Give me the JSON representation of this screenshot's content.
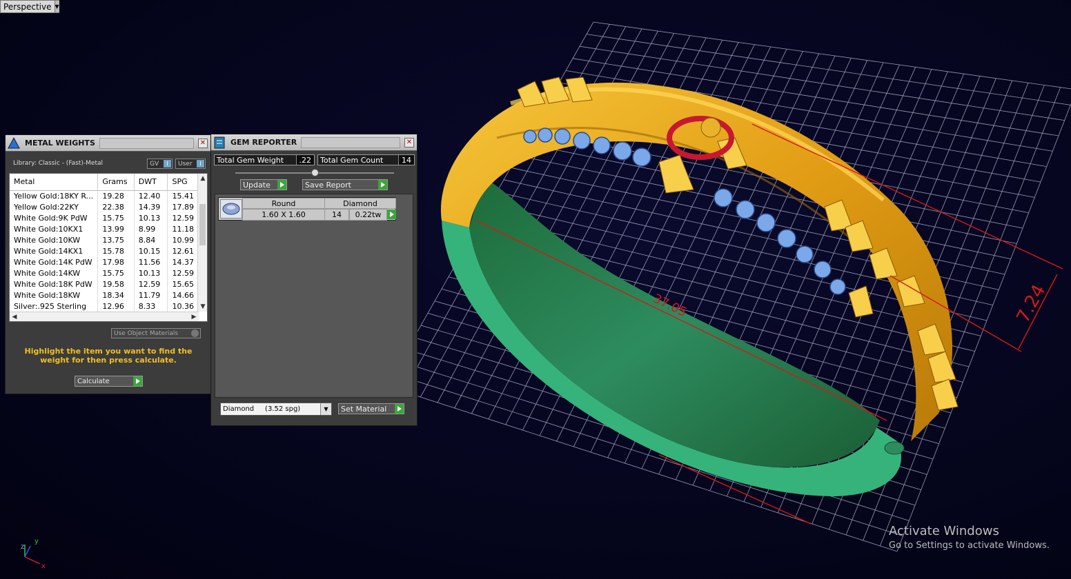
{
  "viewport": {
    "mode_label": "Perspective",
    "dimension_vertical": "7.24",
    "dimension_diagonal": "37.05",
    "axis_labels": [
      "z",
      "y",
      "x"
    ]
  },
  "metal_weights": {
    "title": "METAL WEIGHTS",
    "library": "Library: Classic - (Fast)-Metal",
    "toggle_gv": "GV",
    "toggle_user": "User",
    "columns": [
      "Metal",
      "Grams",
      "DWT",
      "SPG"
    ],
    "rows": [
      [
        "Yellow Gold:18KY R...",
        "19.28",
        "12.40",
        "15.41"
      ],
      [
        "Yellow Gold:22KY",
        "22.38",
        "14.39",
        "17.89"
      ],
      [
        "White Gold:9K PdW",
        "15.75",
        "10.13",
        "12.59"
      ],
      [
        "White Gold:10KX1",
        "13.99",
        "8.99",
        "11.18"
      ],
      [
        "White Gold:10KW",
        "13.75",
        "8.84",
        "10.99"
      ],
      [
        "White Gold:14KX1",
        "15.78",
        "10.15",
        "12.61"
      ],
      [
        "White Gold:14K PdW",
        "17.98",
        "11.56",
        "14.37"
      ],
      [
        "White Gold:14KW",
        "15.75",
        "10.13",
        "12.59"
      ],
      [
        "White Gold:18K PdW",
        "19.58",
        "12.59",
        "15.65"
      ],
      [
        "White Gold:18KW",
        "18.34",
        "11.79",
        "14.66"
      ],
      [
        "Silver:.925 Sterling",
        "12.96",
        "8.33",
        "10.36"
      ]
    ],
    "use_object_materials": "Use Object Materials",
    "hint": "Highlight the item you want to find the weight for then press calculate.",
    "calculate": "Calculate"
  },
  "gem_reporter": {
    "title": "GEM REPORTER",
    "total_weight_label": "Total Gem Weight",
    "total_weight_value": ".22",
    "total_count_label": "Total Gem Count",
    "total_count_value": "14",
    "update": "Update",
    "save_report": "Save Report",
    "gem": {
      "shape": "Round",
      "type": "Diamond",
      "size": "1.60 X 1.60",
      "count": "14",
      "weight": "0.22tw"
    },
    "material_select": "Diamond     (3.52 spg)",
    "set_material": "Set Material"
  },
  "watermark": {
    "line1": "Activate Windows",
    "line2": "Go to Settings to activate Windows."
  },
  "colors": {
    "gold": "#e8a81c",
    "green": "#2fa86a",
    "grid": "#cfd3e8",
    "dimension": "#d81818",
    "hint": "#f0c020"
  }
}
